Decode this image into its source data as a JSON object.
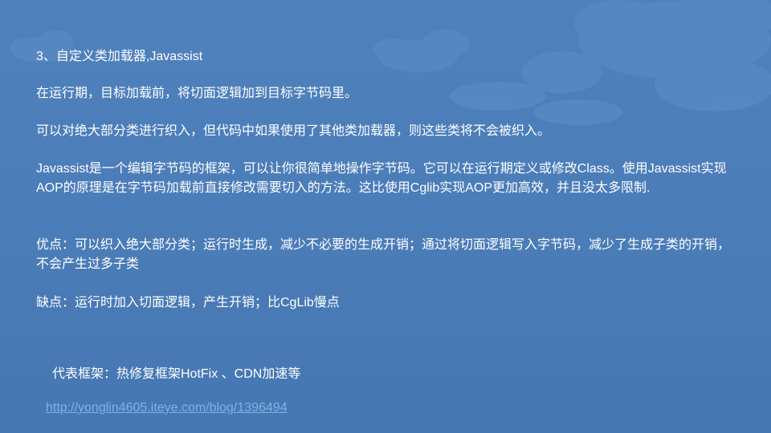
{
  "slide": {
    "heading": "3、自定义类加载器,Javassist",
    "paragraphs": [
      "在运行期，目标加载前，将切面逻辑加到目标字节码里。",
      "可以对绝大部分类进行织入，但代码中如果使用了其他类加载器，则这些类将不会被织入。",
      "Javassist是一个编辑字节码的框架，可以让你很简单地操作字节码。它可以在运行期定义或修改Class。使用Javassist实现AOP的原理是在字节码加载前直接修改需要切入的方法。这比使用Cglib实现AOP更加高效，并且没太多限制.",
      "优点：可以织入绝大部分类；运行时生成，减少不必要的生成开销；通过将切面逻辑写入字节码，减少了生成子类的开销，不会产生过多子类",
      "缺点：运行时加入切面逻辑，产生开销；比CgLib慢点"
    ],
    "frameworks": "代表框架：热修复框架HotFix 、CDN加速等",
    "link": "http://yonglin4605.iteye.com/blog/1396494"
  },
  "colors": {
    "background": "#4a7cb8",
    "cloud": "#5b8cc6",
    "text": "#ffffff",
    "link": "#7fb2e6"
  }
}
